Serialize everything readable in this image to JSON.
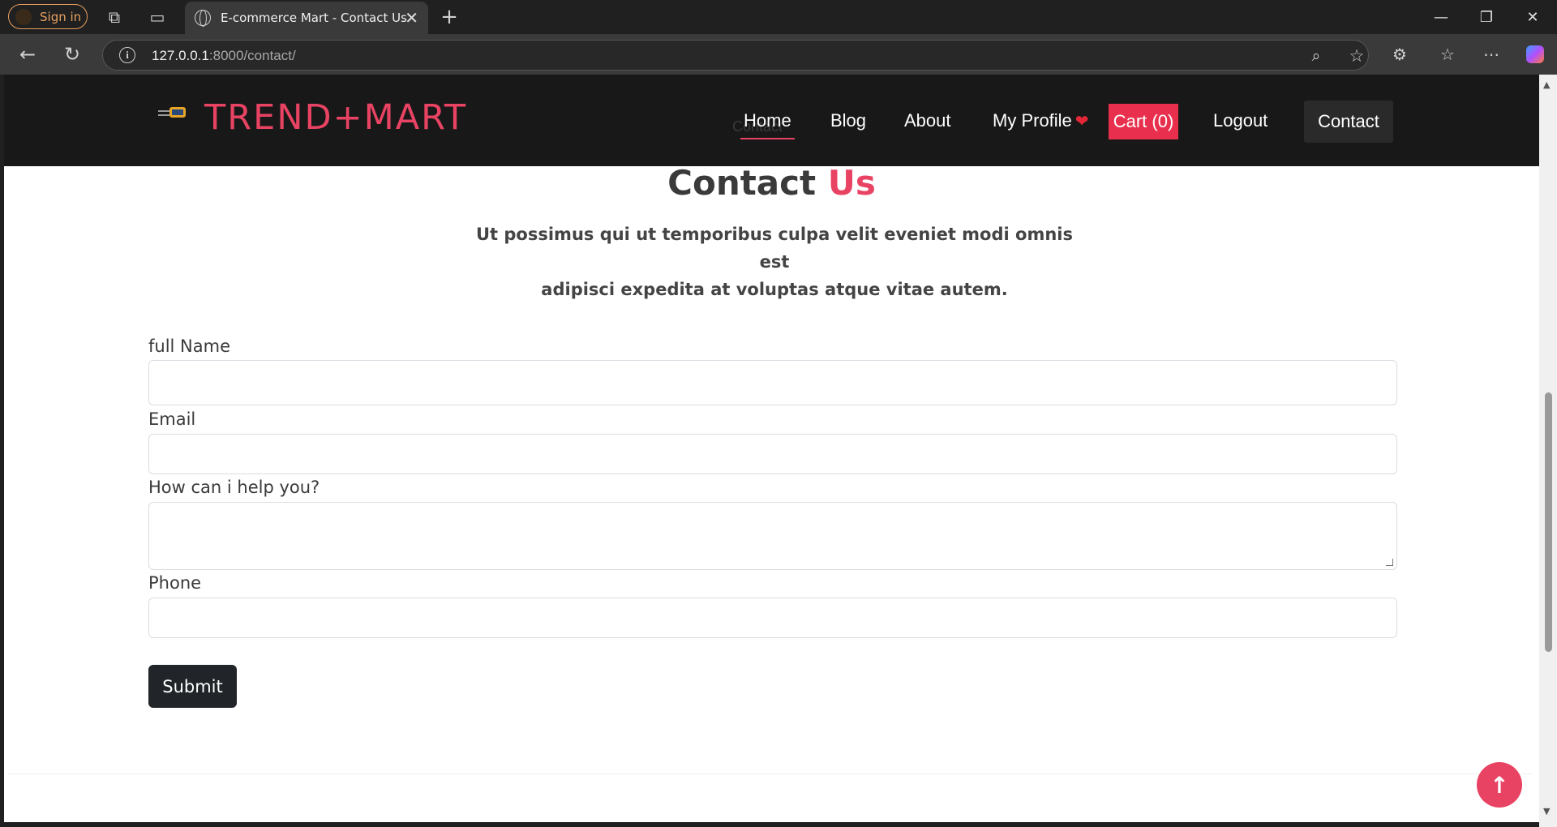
{
  "browser": {
    "sign_in_label": "Sign in",
    "tab_title": "E-commerce Mart - Contact Us",
    "url_host": "127.0.0.1",
    "url_rest": ":8000/contact/"
  },
  "site": {
    "logo_text": "TREND+MART",
    "nav": {
      "home": "Home",
      "blog": "Blog",
      "about": "About",
      "profile": "My Profile",
      "cart": "Cart (0)",
      "logout": "Logout",
      "contact": "Contact"
    },
    "ghost_contact": "Contact"
  },
  "contact": {
    "heading_main": "Contact",
    "heading_accent": "Us",
    "subtext_line1": "Ut possimus qui ut temporibus culpa velit eveniet modi omnis est",
    "subtext_line2": "adipisci expedita at voluptas atque vitae autem.",
    "fields": {
      "name_label": "full Name",
      "email_label": "Email",
      "message_label": "How can i help you?",
      "phone_label": "Phone"
    },
    "submit_label": "Submit"
  },
  "colors": {
    "accent": "#e84363",
    "cart_bg": "#e8304e",
    "header_bg": "#181818",
    "submit_bg": "#212529"
  },
  "icons": [
    "tab-actions-icon",
    "vertical-tabs-icon",
    "globe-icon",
    "close-icon",
    "new-tab-icon",
    "back-icon",
    "refresh-icon",
    "info-icon",
    "zoom-icon",
    "favorite-star-icon",
    "extensions-icon",
    "favorites-icon",
    "more-icon",
    "copilot-icon",
    "heart-icon",
    "arrow-up-icon"
  ]
}
